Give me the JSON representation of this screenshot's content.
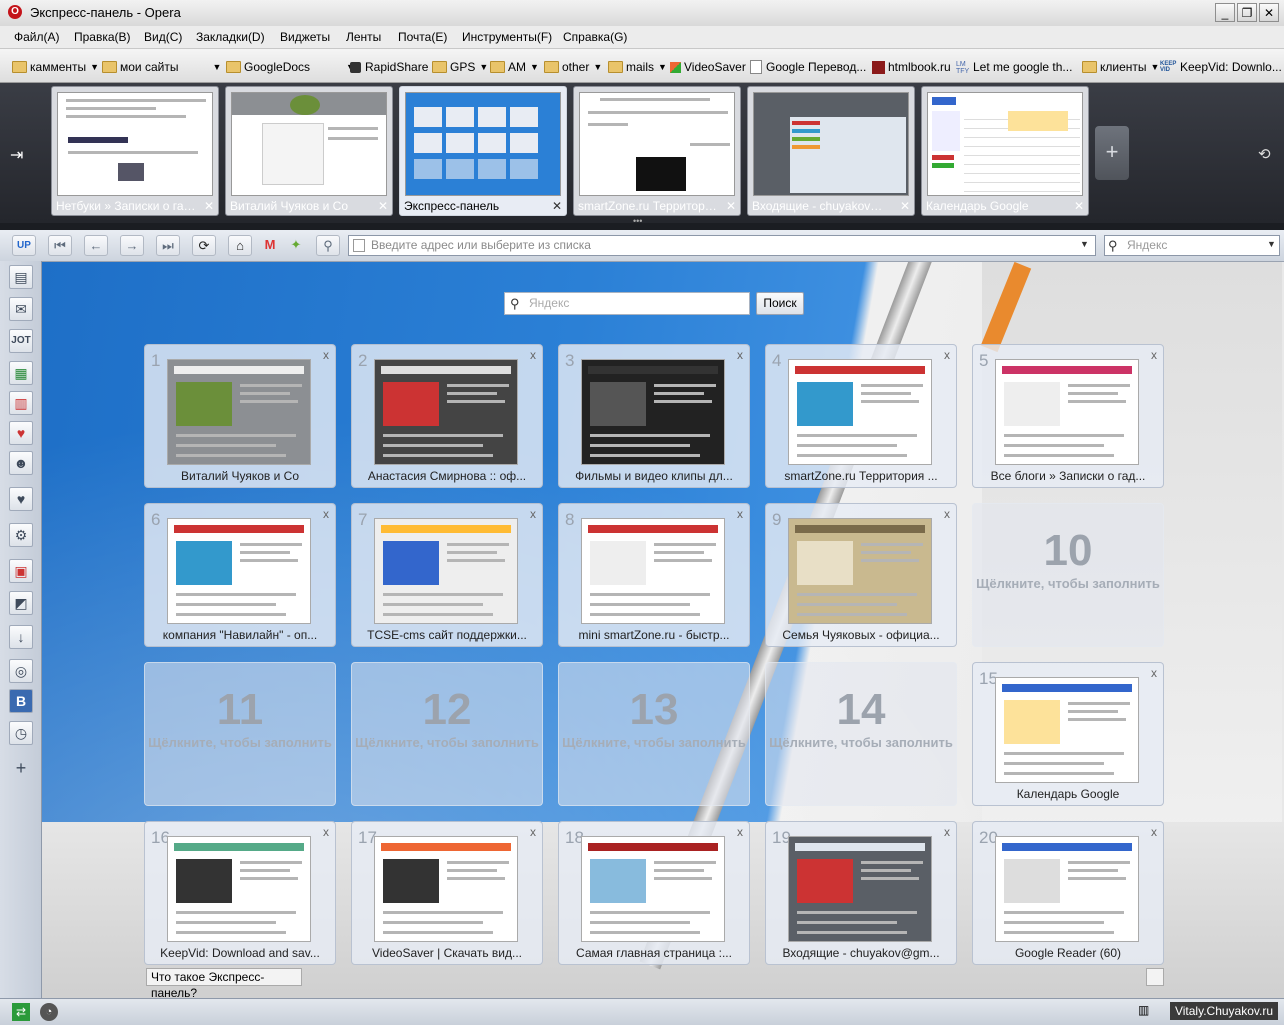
{
  "window": {
    "title": "Экспресс-панель - Opera",
    "logo_letter": "O",
    "controls": [
      "_",
      "❐",
      "✕"
    ]
  },
  "menu": [
    "Файл(A)",
    "Правка(B)",
    "Вид(C)",
    "Закладки(D)",
    "Виджеты",
    "Ленты",
    "Почта(E)",
    "Инструменты(F)",
    "Справка(G)"
  ],
  "bookmarks": [
    {
      "label": "камменты",
      "folder": true,
      "caret": true
    },
    {
      "label": "мои сайты",
      "folder": true,
      "caret": true
    },
    {
      "label": "GoogleDocs",
      "folder": true,
      "caret": true
    },
    {
      "label": "RapidShare",
      "folder": false,
      "caret": false
    },
    {
      "label": "GPS",
      "folder": true,
      "caret": true
    },
    {
      "label": "AM",
      "folder": true,
      "caret": true
    },
    {
      "label": "other",
      "folder": true,
      "caret": true
    },
    {
      "label": "mails",
      "folder": true,
      "caret": true
    },
    {
      "label": "VideoSaver",
      "folder": false,
      "caret": false
    },
    {
      "label": "Google Перевод...",
      "folder": false,
      "caret": false
    },
    {
      "label": "htmlbook.ru",
      "folder": false,
      "caret": false
    },
    {
      "label": "Let me google th...",
      "folder": false,
      "caret": false
    },
    {
      "label": "клиенты",
      "folder": true,
      "caret": true
    },
    {
      "label": "KeepVid: Downlo...",
      "folder": false,
      "caret": false
    }
  ],
  "tabs": [
    {
      "label": "Нетбуки » Записки о гадж...",
      "active": false
    },
    {
      "label": "Виталий Чуяков и Со",
      "active": false
    },
    {
      "label": "Экспресс-панель",
      "active": true
    },
    {
      "label": "smartZone.ru Территория ...",
      "active": false
    },
    {
      "label": "Входящие - chuyakov@gm...",
      "active": false
    },
    {
      "label": "Календарь Google",
      "active": false
    }
  ],
  "tab_close": "✕",
  "new_tab": "+",
  "address": {
    "placeholder": "Введите адрес или выберите из списка"
  },
  "websearch": {
    "placeholder": "Яндекс"
  },
  "speeddial": {
    "search_placeholder": "Яндекс",
    "search_button": "Поиск",
    "help_link": "Что такое Экспресс-панель?",
    "empty_hint": "Щёлкните, чтобы заполнить",
    "close": "x",
    "dials": [
      {
        "num": "1",
        "label": "Виталий Чуяков и Со",
        "empty": false
      },
      {
        "num": "2",
        "label": "Анастасия Смирнова :: оф...",
        "empty": false
      },
      {
        "num": "3",
        "label": "Фильмы и видео клипы дл...",
        "empty": false
      },
      {
        "num": "4",
        "label": "smartZone.ru Территория ...",
        "empty": false
      },
      {
        "num": "5",
        "label": "Все блоги » Записки о гад...",
        "empty": false
      },
      {
        "num": "6",
        "label": "компания \"Навилайн\" - оп...",
        "empty": false
      },
      {
        "num": "7",
        "label": "TCSE-cms сайт поддержки...",
        "empty": false
      },
      {
        "num": "8",
        "label": "mini smartZone.ru - быстр...",
        "empty": false
      },
      {
        "num": "9",
        "label": "Семья Чуяковых - официа...",
        "empty": false
      },
      {
        "num": "10",
        "label": "",
        "empty": true
      },
      {
        "num": "11",
        "label": "",
        "empty": true
      },
      {
        "num": "12",
        "label": "",
        "empty": true
      },
      {
        "num": "13",
        "label": "",
        "empty": true
      },
      {
        "num": "14",
        "label": "",
        "empty": true
      },
      {
        "num": "15",
        "label": "Календарь Google",
        "empty": false
      },
      {
        "num": "16",
        "label": "KeepVid: Download and sav...",
        "empty": false
      },
      {
        "num": "17",
        "label": "VideoSaver | Скачать вид...",
        "empty": false
      },
      {
        "num": "18",
        "label": "Самая главная страница :...",
        "empty": false
      },
      {
        "num": "19",
        "label": "Входящие - chuyakov@gm...",
        "empty": false
      },
      {
        "num": "20",
        "label": "Google Reader (60)",
        "empty": false
      }
    ]
  },
  "panel_icons": [
    "up-icon",
    "notes-icon",
    "mail-icon",
    "contacts-icon",
    "downloads-icon",
    "bookmark-icon",
    "bookmark2-icon",
    "person-icon",
    "heart-icon",
    "gear-icon",
    "page-icon",
    "note-icon",
    "download-icon",
    "widget-icon",
    "b-icon",
    "history-icon",
    "add-icon"
  ],
  "credit": "Vitaly.Chuyakov.ru",
  "colors": {
    "accent_blue": "#2b80d6",
    "opera_red": "#c4141a"
  }
}
